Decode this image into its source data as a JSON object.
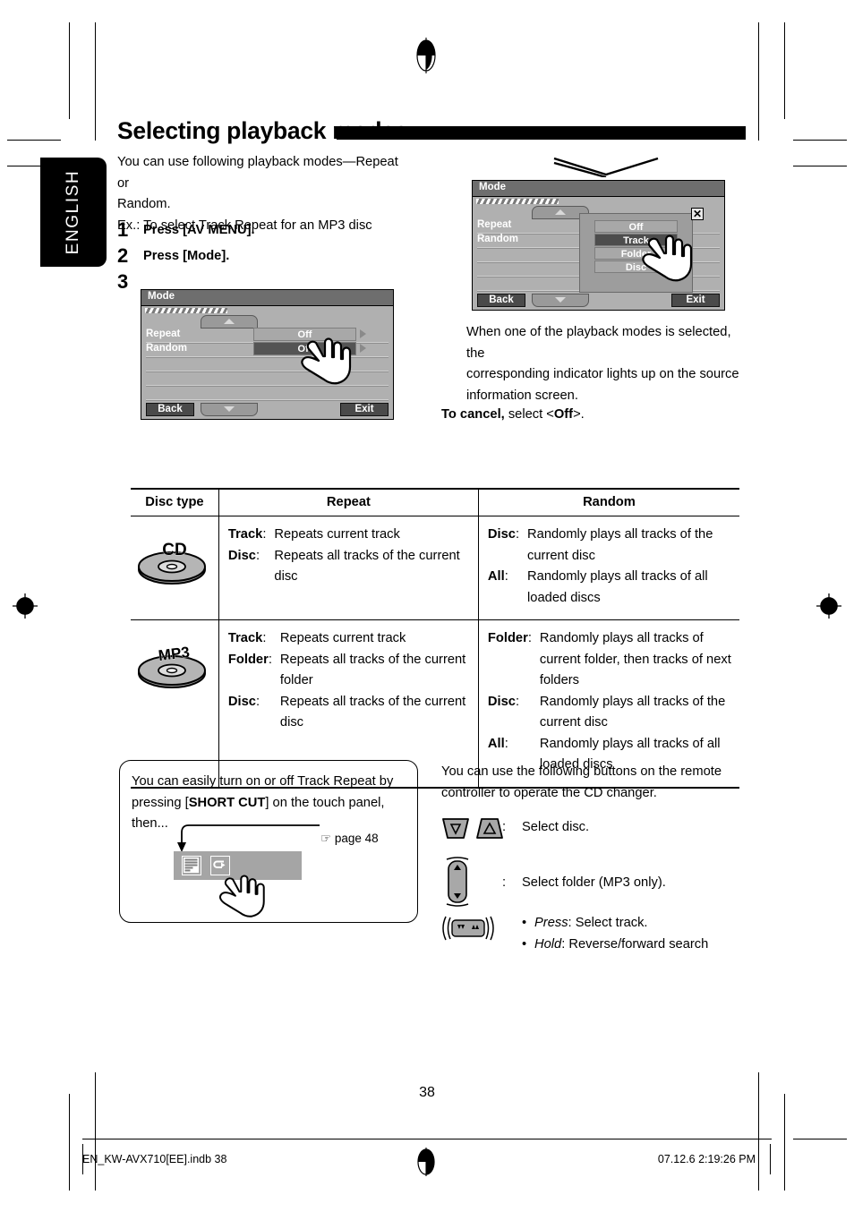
{
  "language_tab": "ENGLISH",
  "header": {
    "title": "Selecting playback modes"
  },
  "intro": {
    "line1": "You can use following playback modes—Repeat or",
    "line2": "Random.",
    "line3": "Ex.: To select Track Repeat for an MP3 disc"
  },
  "steps": [
    {
      "num": "1",
      "text": "Press [AV MENU]."
    },
    {
      "num": "2",
      "text": "Press [Mode]."
    },
    {
      "num": "3",
      "text": ""
    }
  ],
  "screen_step3": {
    "title": "Mode",
    "rows": [
      {
        "label": "Repeat",
        "value": "Off"
      },
      {
        "label": "Random",
        "value": "Off"
      }
    ],
    "back_label": "Back",
    "exit_label": "Exit"
  },
  "screen_popup": {
    "title": "Mode",
    "rows": [
      {
        "label": "Repeat"
      },
      {
        "label": "Random"
      }
    ],
    "options": [
      "Off",
      "Track",
      "Folder",
      "Disc"
    ],
    "selected_option": "Track",
    "close_label": "✕",
    "back_label": "Back",
    "exit_label": "Exit"
  },
  "after_note": {
    "line1": "When one of the playback modes is selected, the",
    "line2": "corresponding indicator lights up on the source",
    "line3": "information screen."
  },
  "to_cancel": {
    "bold": "To cancel,",
    "rest": " select <",
    "value": "Off",
    "tail": ">."
  },
  "table": {
    "headers": [
      "Disc type",
      "Repeat",
      "Random"
    ],
    "rows": [
      {
        "disc_type": "CD",
        "repeat": [
          {
            "term": "Track",
            "sep": ":",
            "def": "Repeats current track"
          },
          {
            "term": "Disc",
            "sep": ":",
            "def": "Repeats all tracks of the current disc"
          }
        ],
        "random": [
          {
            "term": "Disc",
            "sep": ":",
            "def": "Randomly plays all tracks of the current disc"
          },
          {
            "term": "All",
            "sep": ":",
            "def": "Randomly plays all tracks of all loaded discs"
          }
        ]
      },
      {
        "disc_type": "MP3",
        "repeat": [
          {
            "term": "Track",
            "sep": ":",
            "def": "Repeats current track"
          },
          {
            "term": "Folder",
            "sep": ":",
            "def": "Repeats all tracks of the current folder"
          },
          {
            "term": "Disc",
            "sep": ":",
            "def": "Repeats all tracks of the current disc"
          }
        ],
        "random": [
          {
            "term": "Folder",
            "sep": ":",
            "def": "Randomly plays all tracks of current folder, then tracks of next folders"
          },
          {
            "term": "Disc",
            "sep": ":",
            "def": "Randomly plays all tracks of the current disc"
          },
          {
            "term": "All",
            "sep": ":",
            "def": "Randomly plays all tracks of all loaded discs"
          }
        ]
      }
    ]
  },
  "tip": {
    "line1_a": "You can easily turn on or off Track Repeat by",
    "line2_a": "pressing [",
    "line2_b": "SHORT CUT",
    "line2_c": "] on the touch panel, then...",
    "page_ref": "page 48",
    "page_ref_icon": "☞"
  },
  "remote": {
    "intro_line1": "You can use the following buttons on the remote",
    "intro_line2": "controller to operate the CD changer.",
    "rows": [
      {
        "colon": ":",
        "text": "Select disc."
      },
      {
        "colon": ":",
        "text": "Select folder (MP3 only)."
      },
      {
        "colon": "",
        "bullets": [
          {
            "em": "Press",
            "rest": ": Select track."
          },
          {
            "em": "Hold",
            "rest": ": Reverse/forward search"
          }
        ]
      }
    ]
  },
  "footer": {
    "page_number": "38",
    "file": "EN_KW-AVX710[EE].indb   38",
    "timestamp": "07.12.6   2:19:26 PM"
  }
}
